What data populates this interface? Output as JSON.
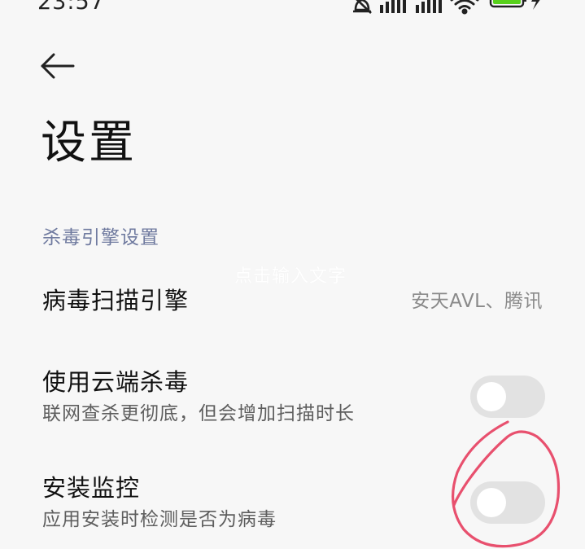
{
  "status_bar": {
    "time": "23:57",
    "battery_level": "80",
    "icons": [
      "mute-bell-icon",
      "signal-icon",
      "signal-icon",
      "wifi-icon",
      "battery-icon",
      "charging-icon"
    ]
  },
  "header": {
    "back_icon": "back-arrow-icon",
    "title": "设置"
  },
  "section": {
    "label": "杀毒引擎设置"
  },
  "overlay_text": "点击输入文字",
  "rows": [
    {
      "title": "病毒扫描引擎",
      "value": "安天AVL、腾讯"
    },
    {
      "title": "使用云端杀毒",
      "subtitle": "联网查杀更彻底，但会增加扫描时长",
      "toggle_on": false
    },
    {
      "title": "安装监控",
      "subtitle": "应用安装时检测是否为病毒",
      "toggle_on": false
    }
  ],
  "colors": {
    "background": "#f7f7f7",
    "section_header": "#6f7a9f",
    "toggle_off": "#e2e2e2",
    "annotation": "#e8506e",
    "battery_green": "#58d11c"
  }
}
